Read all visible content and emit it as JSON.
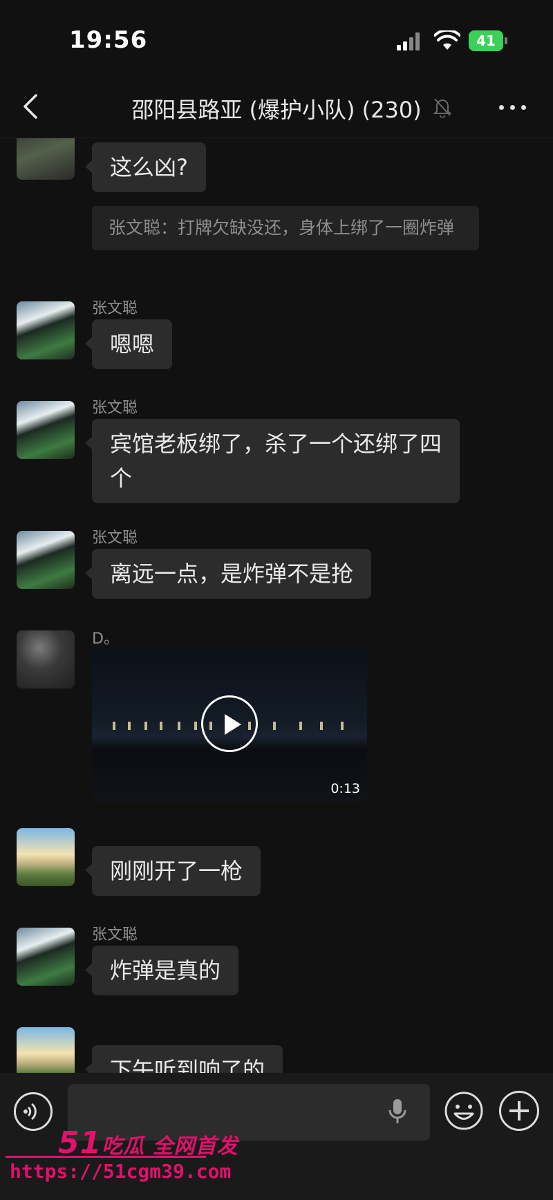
{
  "status_bar": {
    "time": "19:56",
    "battery": "41"
  },
  "header": {
    "title": "邵阳县路亚 (爆护小队) (230)"
  },
  "messages": [
    {
      "type": "text",
      "sender": "",
      "text": "这么凶?",
      "quote": "张文聪：打牌欠缺没还，身体上绑了一圈炸弹"
    },
    {
      "type": "text",
      "sender": "张文聪",
      "text": "嗯嗯"
    },
    {
      "type": "text",
      "sender": "张文聪",
      "text": "宾馆老板绑了，杀了一个还绑了四个"
    },
    {
      "type": "text",
      "sender": "张文聪",
      "text": "离远一点，是炸弹不是抢"
    },
    {
      "type": "video",
      "sender": "D。",
      "duration": "0:13"
    },
    {
      "type": "text",
      "sender": "",
      "text": "刚刚开了一枪"
    },
    {
      "type": "text",
      "sender": "张文聪",
      "text": "炸弹是真的"
    },
    {
      "type": "text",
      "sender": "",
      "text": "下午听到响了的"
    }
  ],
  "input_bar": {
    "placeholder": ""
  },
  "watermark": {
    "brand_num": "51",
    "brand_text": "吃瓜 全网首发",
    "url": "https://51cgm39.com"
  },
  "colors": {
    "background": "#111111",
    "bubble": "#2c2c2c",
    "watermark": "#e0126b",
    "battery": "#3bd05a"
  }
}
